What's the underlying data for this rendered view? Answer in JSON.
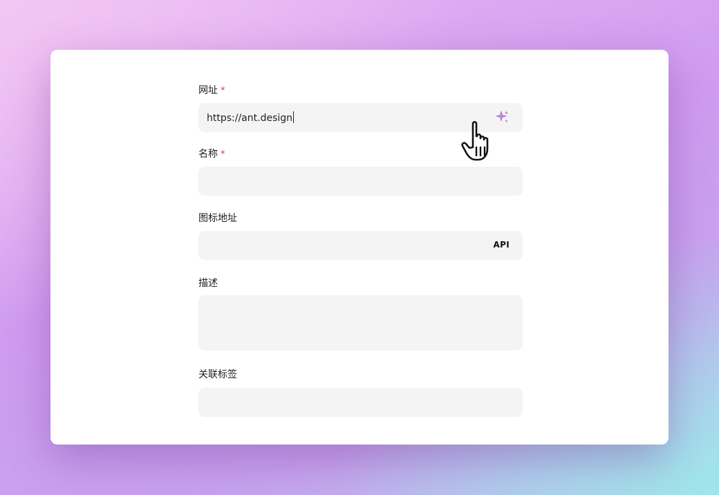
{
  "form": {
    "url": {
      "label": "网址",
      "required_mark": "*",
      "value": "https://ant.design",
      "action_icon": "sparkle-icon",
      "action_color": "#b06ad6"
    },
    "name": {
      "label": "名称",
      "required_mark": "*",
      "value": ""
    },
    "icon_url": {
      "label": "图标地址",
      "value": "",
      "badge": "API"
    },
    "description": {
      "label": "描述",
      "value": ""
    },
    "tags": {
      "label": "关联标签",
      "value": ""
    }
  },
  "colors": {
    "required": "#e0384a",
    "field_background": "#f4f4f5",
    "card_background": "#ffffff"
  },
  "cursor": {
    "icon": "pointer-hand-icon"
  }
}
